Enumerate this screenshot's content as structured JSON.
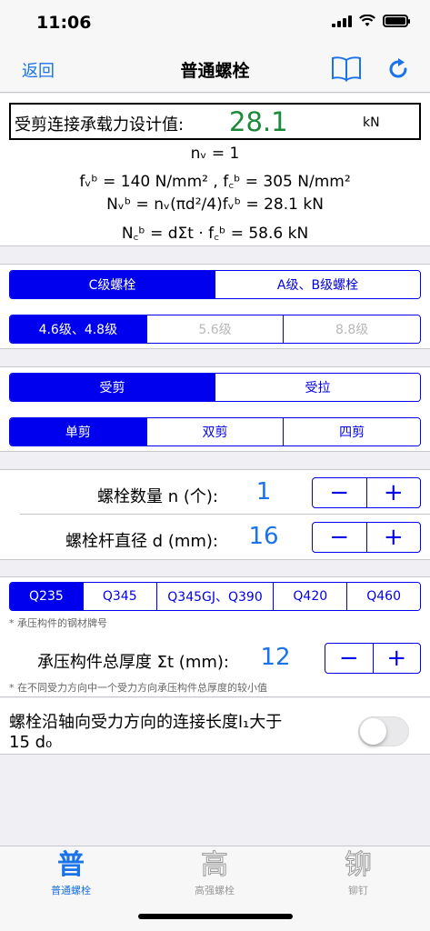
{
  "status": {
    "time": "11:06"
  },
  "nav": {
    "back": "返回",
    "title": "普通螺栓"
  },
  "result": {
    "label": "受剪连接承载力设计值:",
    "value": "28.1",
    "unit": "kN",
    "formulas": [
      "nᵥ = 1",
      "fᵥᵇ = 140 N/mm² , f꜀ᵇ = 305 N/mm²",
      "Nᵥᵇ = nᵥ(πd²/4)fᵥᵇ = 28.1 kN",
      "N꜀ᵇ = dΣt · f꜀ᵇ = 58.6 kN"
    ]
  },
  "bolt_class": {
    "options": [
      "C级螺栓",
      "A级、B级螺栓"
    ],
    "selected": 0
  },
  "bolt_grade": {
    "options": [
      "4.6级、4.8级",
      "5.6级",
      "8.8级"
    ],
    "selected": 0
  },
  "load_type": {
    "options": [
      "受剪",
      "受拉"
    ],
    "selected": 0
  },
  "shear_type": {
    "options": [
      "单剪",
      "双剪",
      "四剪"
    ],
    "selected": 0
  },
  "count": {
    "label": "螺栓数量  n (个):",
    "value": "1",
    "minus": "−",
    "plus": "+"
  },
  "diameter": {
    "label": "螺栓杆直径  d (mm):",
    "value": "16",
    "minus": "−",
    "plus": "+"
  },
  "steel": {
    "options": [
      "Q235",
      "Q345",
      "Q345GJ、Q390",
      "Q420",
      "Q460"
    ],
    "selected": 0,
    "note": "* 承压构件的钢材牌号"
  },
  "thickness": {
    "label": "承压构件总厚度  Σt (mm):",
    "value": "12",
    "minus": "−",
    "plus": "+",
    "note": "* 在不同受力方向中一个受力方向承压构件总厚度的较小值"
  },
  "long_joint": {
    "line1": "螺栓沿轴向受力方向的连接长度l₁大于",
    "line2": "15 d₀",
    "on": false
  },
  "tabs": [
    {
      "glyph": "普",
      "label": "普通螺栓",
      "active": true
    },
    {
      "glyph": "高",
      "label": "高强螺栓",
      "active": false
    },
    {
      "glyph": "铆",
      "label": "铆钉",
      "active": false
    }
  ],
  "colors": {
    "accent": "#0000ee",
    "link": "#1a73e8",
    "result": "#1b8a3a"
  }
}
